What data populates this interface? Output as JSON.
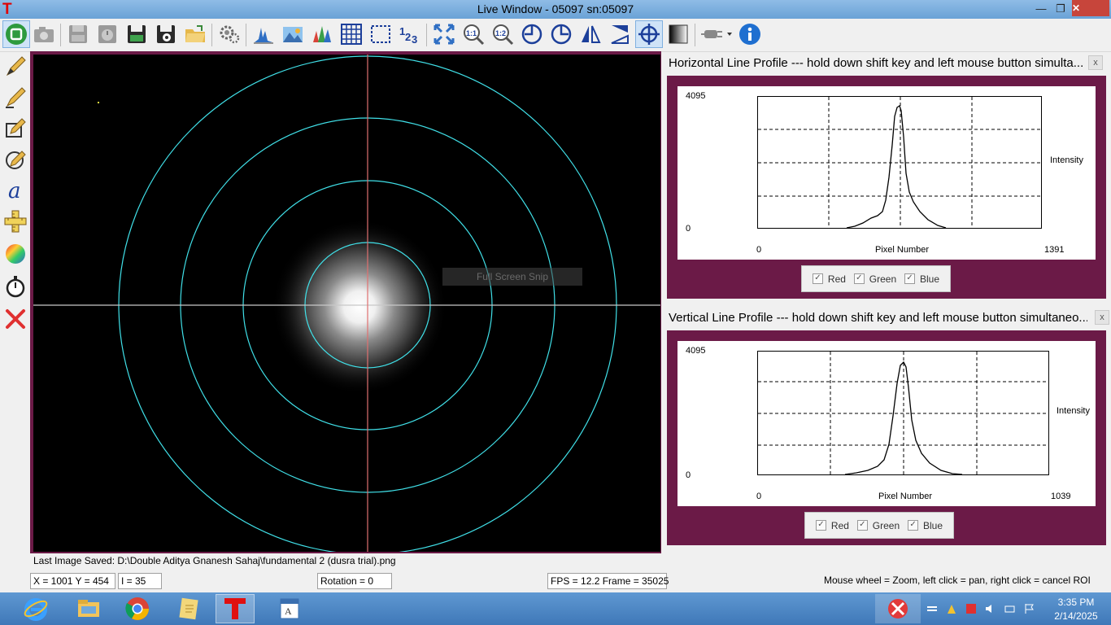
{
  "window": {
    "title": "Live Window - 05097   sn:05097",
    "minimize": "—",
    "restore": "❐",
    "close": "✕"
  },
  "toolbar_icons": [
    "stop-icon",
    "camera-icon",
    "record-icon",
    "timer-save-icon",
    "save-icon",
    "save-settings-icon",
    "open-folder-icon",
    "settings-gears-icon",
    "histogram-icon",
    "landscape-icon",
    "multi-histogram-icon",
    "grid-icon",
    "roi-icon",
    "numbering-icon",
    "fit-screen-icon",
    "zoom-1-1-icon",
    "zoom-1-2-icon",
    "rotate-left-icon",
    "rotate-right-icon",
    "flip-horizontal-icon",
    "flip-vertical-icon",
    "crosshair-icon",
    "grayscale-icon",
    "plug-icon",
    "info-icon"
  ],
  "tool_labels": {
    "zoom11": "1:1",
    "zoom12": "1:2",
    "numbering": "123"
  },
  "left_tools": [
    "pencil-icon",
    "pencil-line-icon",
    "pencil-box-icon",
    "pencil-circle-icon",
    "text-tool-icon",
    "ruler-cross-icon",
    "color-wheel-icon",
    "stopwatch-icon",
    "delete-x-icon"
  ],
  "left_labels": {
    "text_tool": "a"
  },
  "overlay": {
    "snip_label": "Full Screen Snip"
  },
  "horizontal_profile": {
    "title": "Horizontal Line Profile --- hold down shift key and left mouse button simulta...",
    "close": "x",
    "y_max": "4095",
    "y_min": "0",
    "x_min": "0",
    "x_max": "1391",
    "x_label": "Pixel Number",
    "y_label": "Intensity",
    "checkboxes": [
      "Red",
      "Green",
      "Blue"
    ]
  },
  "vertical_profile": {
    "title": "Vertical Line Profile --- hold down shift key and left mouse button simultaneo...",
    "close": "x",
    "y_max": "4095",
    "y_min": "0",
    "x_min": "0",
    "x_max": "1039",
    "x_label": "Pixel Number",
    "y_label": "Intensity",
    "checkboxes": [
      "Red",
      "Green",
      "Blue"
    ]
  },
  "status": {
    "last_saved": "Last Image Saved: D:\\Double Aditya Gnanesh Sahaj\\fundamental 2 (dusra trial).png",
    "xy": "X = 1001  Y = 454",
    "intensity": "I = 35",
    "rotation": "Rotation = 0",
    "fps": "FPS = 12.2  Frame = 35025",
    "hint": "Mouse wheel = Zoom, left click = pan, right click = cancel ROI"
  },
  "taskbar": {
    "apps": [
      "ie-icon",
      "file-explorer-icon",
      "chrome-icon",
      "notes-app-icon",
      "thorcam-icon",
      "wordpad-icon"
    ],
    "time": "3:35 PM",
    "date": "2/14/2025"
  },
  "colors": {
    "titlebar": "#6fa8dc",
    "frame": "#6b1a47",
    "ring": "#40e0e8",
    "crosshair_h": "#c8c8c8",
    "crosshair_v": "#e07070",
    "taskbar": "#4b86c4"
  }
}
